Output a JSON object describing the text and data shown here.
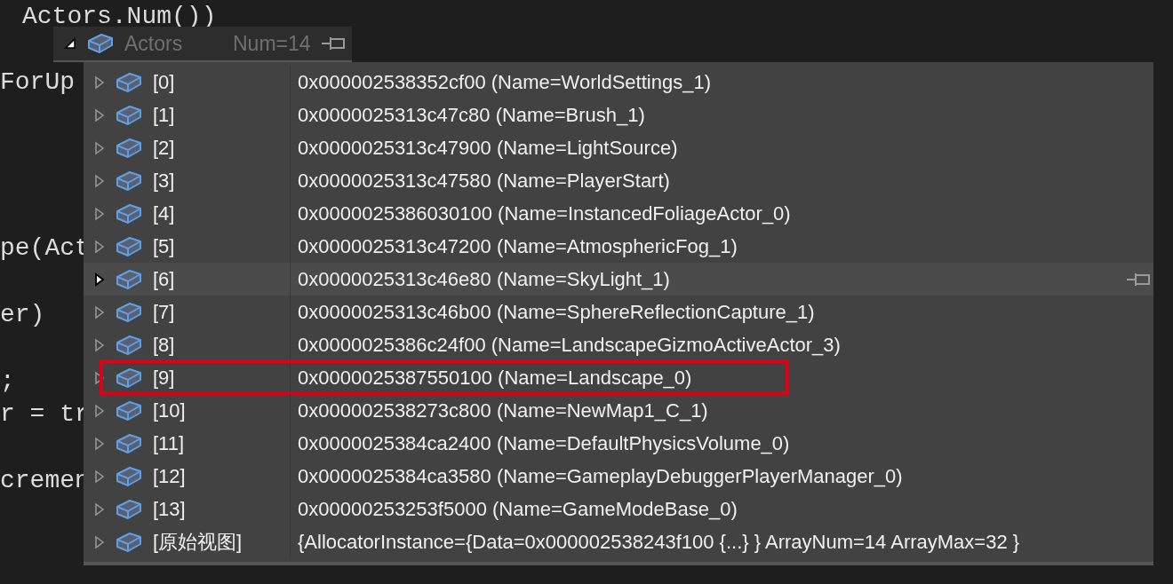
{
  "code_lines": [
    {
      "text": "Actors.Num())"
    },
    {
      "text": "ForUp"
    },
    {
      "text": "pe(Act"
    },
    {
      "text": "er)"
    },
    {
      "text": ";"
    },
    {
      "text": "r = tr"
    },
    {
      "text": "cremen"
    }
  ],
  "watch": {
    "name": "Actors",
    "value": "Num=14",
    "expanded": true
  },
  "rows": [
    {
      "name": "[0]",
      "value": "0x000002538352cf00 (Name=WorldSettings_1)",
      "hovered": false,
      "highlighted": false
    },
    {
      "name": "[1]",
      "value": "0x0000025313c47c80 (Name=Brush_1)",
      "hovered": false,
      "highlighted": false
    },
    {
      "name": "[2]",
      "value": "0x0000025313c47900 (Name=LightSource)",
      "hovered": false,
      "highlighted": false
    },
    {
      "name": "[3]",
      "value": "0x0000025313c47580 (Name=PlayerStart)",
      "hovered": false,
      "highlighted": false
    },
    {
      "name": "[4]",
      "value": "0x0000025386030100 (Name=InstancedFoliageActor_0)",
      "hovered": false,
      "highlighted": false
    },
    {
      "name": "[5]",
      "value": "0x0000025313c47200 (Name=AtmosphericFog_1)",
      "hovered": false,
      "highlighted": false
    },
    {
      "name": "[6]",
      "value": "0x0000025313c46e80 (Name=SkyLight_1)",
      "hovered": true,
      "highlighted": false
    },
    {
      "name": "[7]",
      "value": "0x0000025313c46b00 (Name=SphereReflectionCapture_1)",
      "hovered": false,
      "highlighted": false
    },
    {
      "name": "[8]",
      "value": "0x0000025386c24f00 (Name=LandscapeGizmoActiveActor_3)",
      "hovered": false,
      "highlighted": false
    },
    {
      "name": "[9]",
      "value": "0x0000025387550100 (Name=Landscape_0)",
      "hovered": false,
      "highlighted": true
    },
    {
      "name": "[10]",
      "value": "0x000002538273c800 (Name=NewMap1_C_1)",
      "hovered": false,
      "highlighted": false
    },
    {
      "name": "[11]",
      "value": "0x0000025384ca2400 (Name=DefaultPhysicsVolume_0)",
      "hovered": false,
      "highlighted": false
    },
    {
      "name": "[12]",
      "value": "0x0000025384ca3580 (Name=GameplayDebuggerPlayerManager_0)",
      "hovered": false,
      "highlighted": false
    },
    {
      "name": "[13]",
      "value": "0x00000253253f5000 (Name=GameModeBase_0)",
      "hovered": false,
      "highlighted": false
    },
    {
      "name": "[原始视图]",
      "value": "{AllocatorInstance={Data=0x000002538243f100 {...} } ArrayNum=14 ArrayMax=32 }",
      "hovered": false,
      "highlighted": false
    }
  ]
}
